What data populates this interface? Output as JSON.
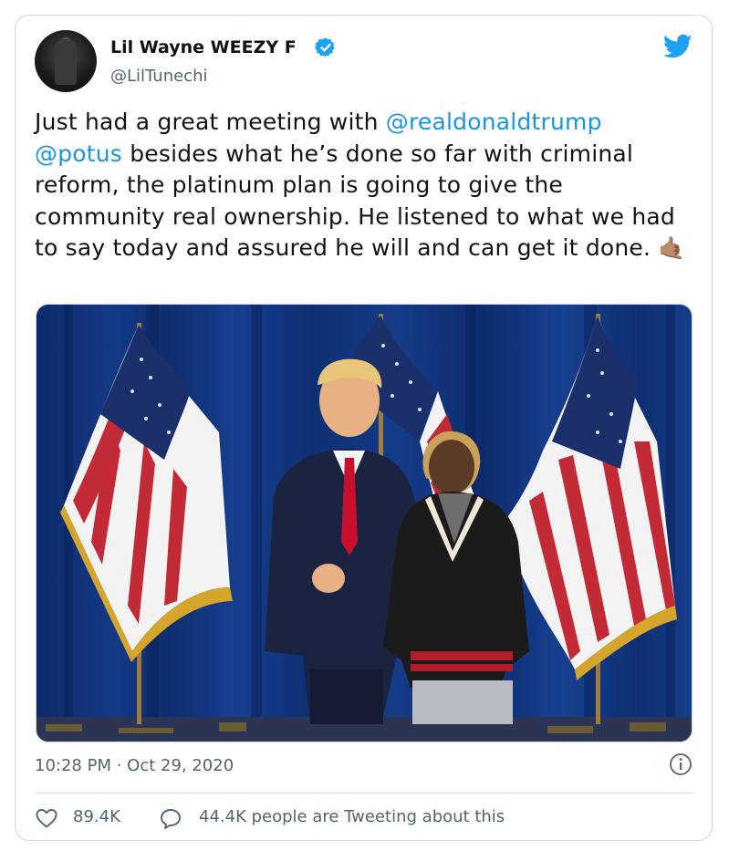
{
  "tweet": {
    "author_name": "Lil Wayne WEEZY F",
    "handle": "@LilTunechi",
    "text_parts": [
      {
        "text": "Just had a great meeting with ",
        "mention": false
      },
      {
        "text": "@realdonaldtrump",
        "mention": true
      },
      {
        "text": " ",
        "mention": false
      },
      {
        "text": "@potus",
        "mention": true
      },
      {
        "text": " besides what he’s done so far with criminal reform, the platinum plan is going to give the community real ownership. He listened to what we had to say today and assured he will and can get it done. ",
        "mention": false
      }
    ],
    "emoji": "🤙🏽",
    "timestamp": "10:28 PM · Oct 29, 2020",
    "likes": "89.4K",
    "tweeting_about": "44.4K people are Tweeting about this"
  },
  "colors": {
    "mention": "#1b95e0",
    "twitter_blue": "#1da1f2",
    "secondary_text": "#536471",
    "border": "#cfd9de"
  },
  "icons": {
    "verified": "verified-badge-icon",
    "logo": "twitter-bird-icon",
    "info": "info-icon",
    "like": "heart-icon",
    "reply": "speech-bubble-icon"
  }
}
